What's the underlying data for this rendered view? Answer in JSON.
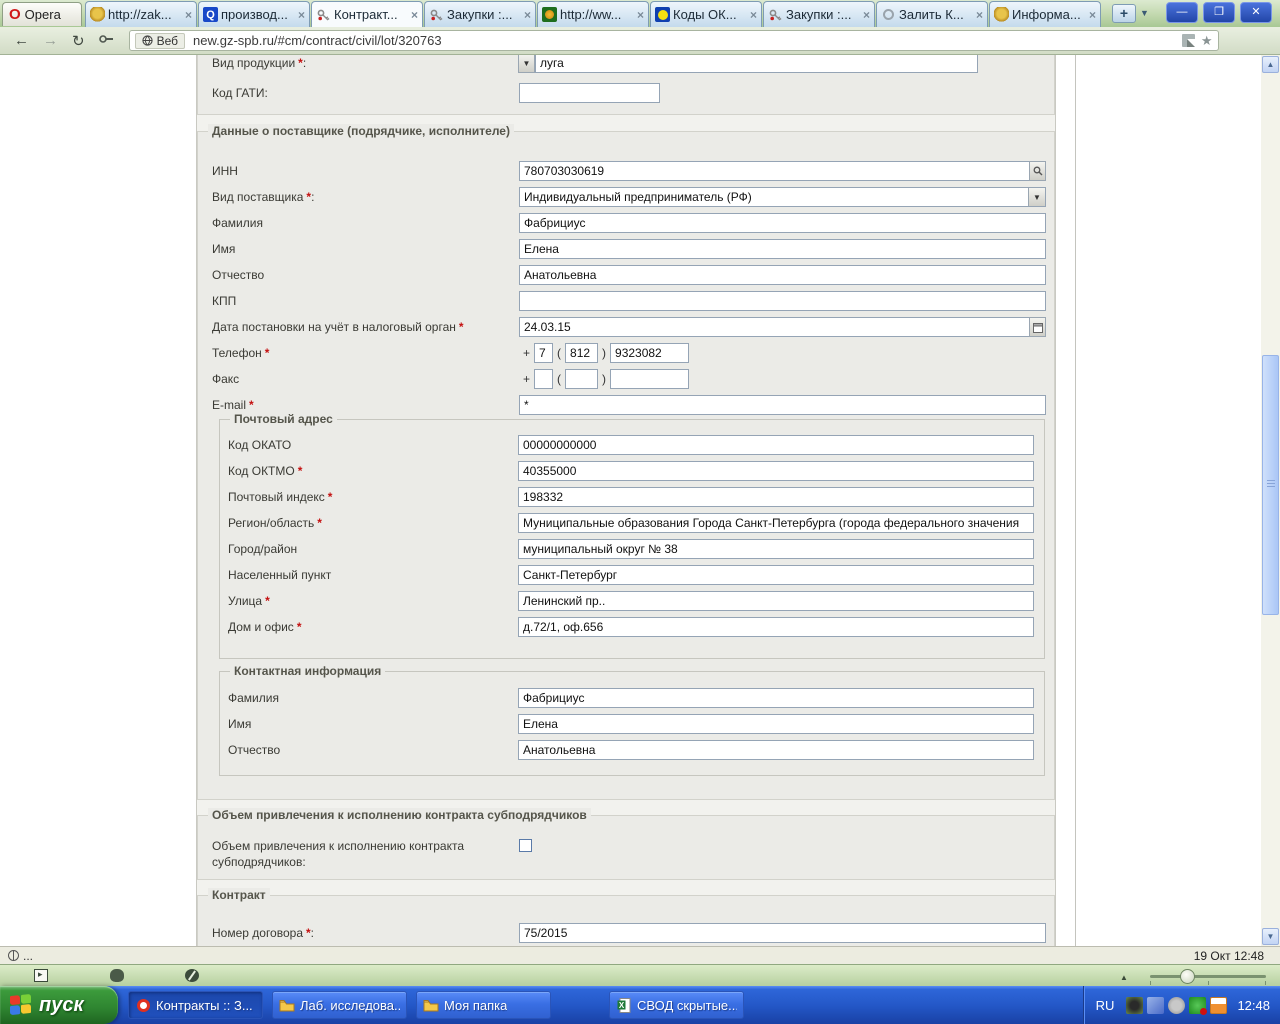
{
  "ui": {
    "req": "*",
    "colon": ":",
    "close_glyph": "×",
    "plus": "+",
    "paren_open": "(",
    "paren_close": ")"
  },
  "browser": {
    "opera_button": "Opera",
    "tabs": [
      {
        "label": "http://zak...",
        "icon": "russia-emblem"
      },
      {
        "label": "производ...",
        "icon": "search-q"
      },
      {
        "label": "Контракт...",
        "icon": "key",
        "active": true
      },
      {
        "label": "Закупки :...",
        "icon": "key"
      },
      {
        "label": "http://ww...",
        "icon": "green-site"
      },
      {
        "label": "Коды ОК...",
        "icon": "yellow-dot"
      },
      {
        "label": "Закупки :...",
        "icon": "key"
      },
      {
        "label": "Залить К...",
        "icon": "loading-ring"
      },
      {
        "label": "Информа...",
        "icon": "russia-emblem"
      }
    ],
    "new_tab_label": "+",
    "window_controls": {
      "minimize": "—",
      "restore": "❐",
      "close": "✕"
    },
    "address": {
      "badge_label": "Веб",
      "url": "new.gz-spb.ru/#cm/contract/civil/lot/320763"
    },
    "statusbar": {
      "left_text": "...",
      "right_text": "19 Окт 12:48"
    }
  },
  "form": {
    "top": {
      "product_type": {
        "label": "Вид продукции",
        "value": "луга"
      },
      "gati_code": {
        "label": "Код ГАТИ",
        "value": ""
      }
    },
    "supplier": {
      "legend": "Данные о поставщике (подрядчике, исполнителе)",
      "inn": {
        "label": "ИНН",
        "value": "780703030619"
      },
      "supplier_type": {
        "label": "Вид поставщика",
        "value": "Индивидуальный предприниматель (РФ)"
      },
      "surname": {
        "label": "Фамилия",
        "value": "Фабрициус"
      },
      "firstname": {
        "label": "Имя",
        "value": "Елена"
      },
      "patronymic": {
        "label": "Отчество",
        "value": "Анатольевна"
      },
      "kpp": {
        "label": "КПП",
        "value": ""
      },
      "tax_date": {
        "label": "Дата постановки на учёт в налоговый орган",
        "value": "24.03.15"
      },
      "phone": {
        "label": "Телефон",
        "country": "7",
        "city": "812",
        "number": "9323082"
      },
      "fax": {
        "label": "Факс",
        "country": "",
        "city": "",
        "number": ""
      },
      "email": {
        "label": "E-mail",
        "value": "*"
      }
    },
    "postal": {
      "legend": "Почтовый адрес",
      "okato": {
        "label": "Код ОКАТО",
        "value": "00000000000"
      },
      "oktmo": {
        "label": "Код ОКТМО",
        "value": "40355000"
      },
      "zip": {
        "label": "Почтовый индекс",
        "value": "198332"
      },
      "region": {
        "label": "Регион/область",
        "value": "Муниципальные образования Города Санкт-Петербурга (города федерального значения"
      },
      "city": {
        "label": "Город/район",
        "value": "муниципальный округ № 38"
      },
      "locality": {
        "label": "Населенный пункт",
        "value": "Санкт-Петербург"
      },
      "street": {
        "label": "Улица",
        "value": "Ленинский пр.."
      },
      "house": {
        "label": "Дом и офис",
        "value": "д.72/1, оф.656"
      }
    },
    "contact": {
      "legend": "Контактная информация",
      "surname": {
        "label": "Фамилия",
        "value": "Фабрициус"
      },
      "firstname": {
        "label": "Имя",
        "value": "Елена"
      },
      "patronymic": {
        "label": "Отчество",
        "value": "Анатольевна"
      }
    },
    "subcontract": {
      "legend": "Объем привлечения к исполнению контракта субподрядчиков",
      "label_line1": "Объем привлечения к исполнению контракта",
      "label_line2": "субподрядчиков:",
      "checked": false
    },
    "contract": {
      "legend": "Контракт",
      "number": {
        "label": "Номер договора",
        "value": "75/2015"
      }
    }
  },
  "taskbar": {
    "start_label": "пуск",
    "items": [
      {
        "label": "Контракты :: З...",
        "icon": "opera",
        "active": true
      },
      {
        "label": "Лаб. исследова...",
        "icon": "folder"
      },
      {
        "label": "Моя папка",
        "icon": "folder"
      },
      {
        "label": "СВОД скрытые...",
        "icon": "excel"
      }
    ],
    "tray": {
      "lang": "RU",
      "time": "12:48"
    }
  }
}
